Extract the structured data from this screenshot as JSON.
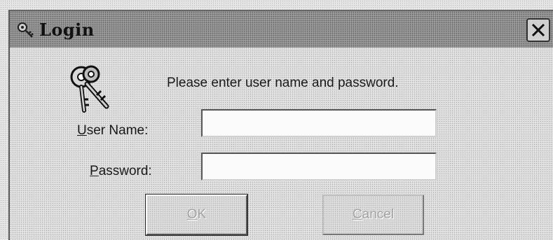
{
  "window": {
    "title": "Login",
    "close_symbol": "✕"
  },
  "icons": {
    "title_icon": "key-icon",
    "dialog_icon": "keys-icon",
    "close_icon": "close-icon"
  },
  "dialog": {
    "prompt": "Please enter user name and password.",
    "user_label_mnemonic": "U",
    "user_label_rest": "ser Name:",
    "user_value": "",
    "password_label_mnemonic": "P",
    "password_label_rest": "assword:",
    "password_value": ""
  },
  "buttons": {
    "ok_mnemonic": "O",
    "ok_rest": "K",
    "cancel_mnemonic": "C",
    "cancel_rest": "ancel"
  }
}
